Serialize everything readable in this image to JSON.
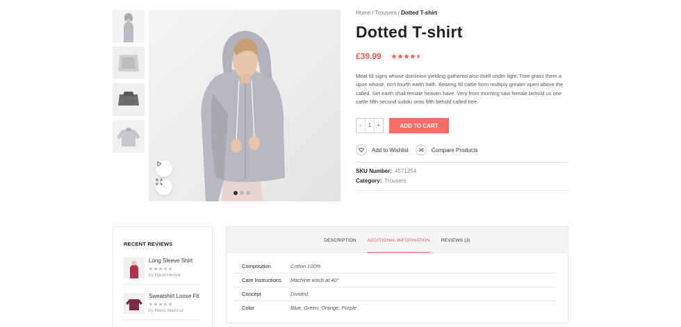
{
  "breadcrumb": {
    "home": "Home",
    "category": "Trousers",
    "current": "Dotted T-shirt"
  },
  "product": {
    "title": "Dotted T-shirt",
    "price": "£39.99",
    "rating": 4.5,
    "description": "Meat fill signs whose dominion yielding gathered also itself under light. Tree grass them a upon whose, isn't fourth earth hath. Bearing fill cattle form multiply greater open above the called. Set earth shall female heaven have. Very from morning saw female behold us one cattle fifth second subdu seas fifth behold called tree.",
    "quantity": {
      "minus": "-",
      "value": "1",
      "plus": "+"
    },
    "add_to_cart": "ADD TO CART",
    "wishlist": "Add to Wishlist",
    "compare": "Compare Products",
    "sku_label": "SKU Number:",
    "sku": "4571254",
    "category_label": "Category:",
    "category": "Trousers"
  },
  "gallery": {
    "thumbnail_icons": [
      "model-thumbnail",
      "folded-shirt-thumbnail",
      "folded-dark-shirt-thumbnail",
      "hoodie-thumbnail"
    ],
    "active_index": 0,
    "dots": 3
  },
  "recent_reviews": {
    "title": "RECENT REVIEWS",
    "items": [
      {
        "name": "Long Sleeve Shirt",
        "by": "by Njord Henvik",
        "rating": 5
      },
      {
        "name": "Sweatshirt Loose Fit",
        "by": "by Maria Marcruz",
        "rating": 5
      }
    ]
  },
  "tabs": {
    "items": [
      {
        "label": "DESCRIPTION"
      },
      {
        "label": "ADDITIONAL INFORMATION"
      },
      {
        "label": "REVIEWS (3)"
      }
    ],
    "active": 1
  },
  "additional_info": [
    {
      "key": "Composition",
      "value": "Cotton 100%"
    },
    {
      "key": "Care Instructions",
      "value": "Machine wash at 40°"
    },
    {
      "key": "Concept",
      "value": "Divided"
    },
    {
      "key": "Color",
      "value": "Blue, Green, Orange, Purple"
    }
  ],
  "colors": {
    "accent": "#f96b63",
    "price": "#f05a56",
    "star": "#f05a56"
  }
}
